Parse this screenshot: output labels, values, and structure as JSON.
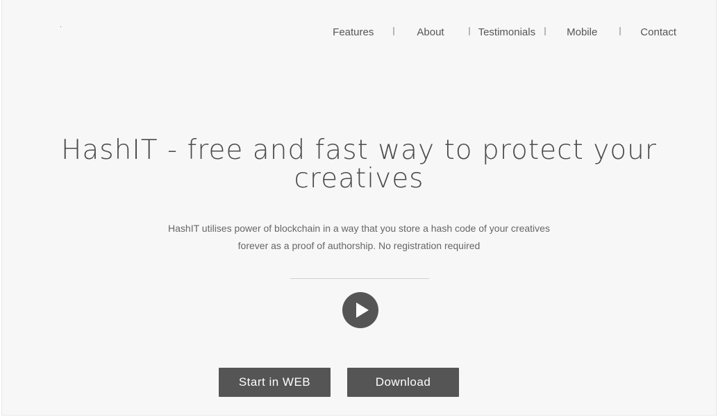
{
  "header": {
    "nav": {
      "features": "Features",
      "about": "About",
      "testimonials": "Testimonials",
      "mobile": "Mobile",
      "contact": "Contact"
    }
  },
  "hero": {
    "title_line1": "HashIT - free and fast way to protect your",
    "title_line2": "creatives",
    "subtitle_line1": "HashIT utilises power of blockchain in a way that you store a hash code of your creatives",
    "subtitle_line2": "forever as a proof of authorship. No registration required",
    "play_icon": "play-icon",
    "start_web_label": "Start in WEB",
    "download_label": "Download"
  },
  "colors": {
    "background": "#f7f7f7",
    "text": "#4a4a4a",
    "button": "#555555",
    "button_text": "#ffffff"
  }
}
